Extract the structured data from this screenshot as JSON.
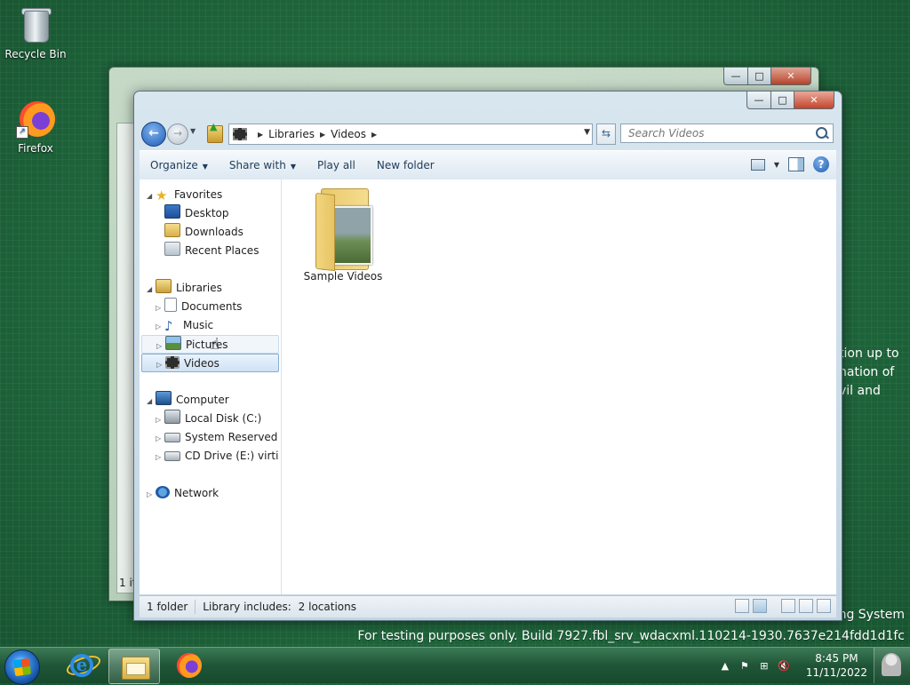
{
  "desktop": {
    "icons": [
      {
        "label": "Recycle Bin",
        "icon": "recycle-bin-icon"
      },
      {
        "label": "Firefox",
        "icon": "firefox-icon"
      }
    ],
    "partial_text_lines": [
      "tion up to",
      "nation of",
      "vil and"
    ],
    "watermark": {
      "line1": "Microsoft Pre-release Windows Operating System",
      "line2": "For testing purposes only. Build 7927.fbl_srv_wdacxml.110214-1930.7637e214fdd1d1fc"
    }
  },
  "back_window": {
    "status_partial": "1 ite"
  },
  "explorer": {
    "caption": {
      "minimize": "—",
      "maximize": "□",
      "close": "✕"
    },
    "breadcrumb": [
      "Libraries",
      "Videos"
    ],
    "search": {
      "placeholder": "Search Videos"
    },
    "toolbar": {
      "organize": "Organize",
      "share_with": "Share with",
      "play_all": "Play all",
      "new_folder": "New folder"
    },
    "nav": {
      "favorites": {
        "label": "Favorites",
        "items": [
          "Desktop",
          "Downloads",
          "Recent Places"
        ]
      },
      "libraries": {
        "label": "Libraries",
        "items": [
          "Documents",
          "Music",
          "Pictures",
          "Videos"
        ]
      },
      "computer": {
        "label": "Computer",
        "items": [
          "Local Disk (C:)",
          "System Reserved (D:",
          "CD Drive (E:) virtio-v"
        ]
      },
      "network": {
        "label": "Network"
      }
    },
    "selected_nav": "Videos",
    "hovered_nav": "Pictures",
    "files": [
      {
        "name": "Sample Videos",
        "icon": "folder-icon"
      }
    ],
    "status": {
      "count": "1 folder",
      "library_includes": "Library includes:",
      "locations": "2 locations"
    }
  },
  "taskbar": {
    "pinned": [
      "internet-explorer-icon",
      "windows-explorer-icon",
      "firefox-icon"
    ],
    "active": "windows-explorer-icon",
    "clock": {
      "time": "8:45 PM",
      "date": "11/11/2022"
    }
  },
  "colors": {
    "desktop": "#1f6a3c",
    "selection": "#cfe2f5",
    "taskbar": "#1f5537"
  }
}
